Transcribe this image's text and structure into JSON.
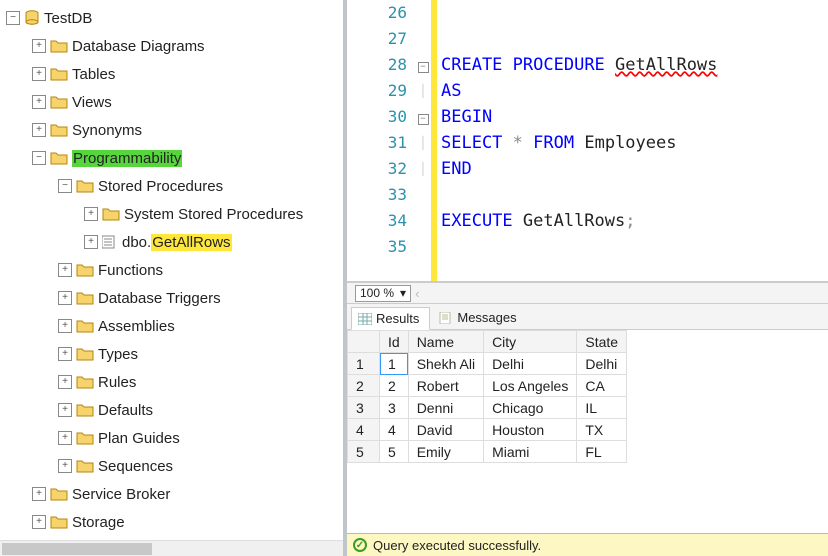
{
  "tree": {
    "root": "TestDB",
    "items": [
      {
        "label": "Database Diagrams",
        "indent": 1,
        "exp": "+",
        "icon": "folder"
      },
      {
        "label": "Tables",
        "indent": 1,
        "exp": "+",
        "icon": "folder"
      },
      {
        "label": "Views",
        "indent": 1,
        "exp": "+",
        "icon": "folder"
      },
      {
        "label": "Synonyms",
        "indent": 1,
        "exp": "+",
        "icon": "folder"
      },
      {
        "label": "Programmability",
        "indent": 1,
        "exp": "-",
        "icon": "folder",
        "hl": "green"
      },
      {
        "label": "Stored Procedures",
        "indent": 2,
        "exp": "-",
        "icon": "folder"
      },
      {
        "label": "System Stored Procedures",
        "indent": 3,
        "exp": "+",
        "icon": "folder"
      },
      {
        "label": "dbo.GetAllRows",
        "indent": 3,
        "exp": "+",
        "icon": "sp",
        "hl": "yellow",
        "hl_start": 4
      },
      {
        "label": "Functions",
        "indent": 2,
        "exp": "+",
        "icon": "folder"
      },
      {
        "label": "Database Triggers",
        "indent": 2,
        "exp": "+",
        "icon": "folder"
      },
      {
        "label": "Assemblies",
        "indent": 2,
        "exp": "+",
        "icon": "folder"
      },
      {
        "label": "Types",
        "indent": 2,
        "exp": "+",
        "icon": "folder"
      },
      {
        "label": "Rules",
        "indent": 2,
        "exp": "+",
        "icon": "folder"
      },
      {
        "label": "Defaults",
        "indent": 2,
        "exp": "+",
        "icon": "folder"
      },
      {
        "label": "Plan Guides",
        "indent": 2,
        "exp": "+",
        "icon": "folder"
      },
      {
        "label": "Sequences",
        "indent": 2,
        "exp": "+",
        "icon": "folder"
      },
      {
        "label": "Service Broker",
        "indent": 1,
        "exp": "+",
        "icon": "folder"
      },
      {
        "label": "Storage",
        "indent": 1,
        "exp": "+",
        "icon": "folder"
      }
    ]
  },
  "editor": {
    "line_start": 26,
    "lines": [
      {
        "n": 26,
        "fold": "",
        "html": ""
      },
      {
        "n": 27,
        "fold": "",
        "html": ""
      },
      {
        "n": 28,
        "fold": "-",
        "html": "<span class='kw'>CREATE</span> <span class='kw'>PROCEDURE</span> <span class='ident-wavy'>GetAllRows</span>"
      },
      {
        "n": 29,
        "fold": "|",
        "html": "<span class='kw'>AS</span>"
      },
      {
        "n": 30,
        "fold": "-",
        "html": "<span class='kw'>BEGIN</span>"
      },
      {
        "n": 31,
        "fold": "|",
        "html": "<span class='kw'>SELECT</span> <span class='op'>*</span> <span class='kw'>FROM</span> Employees"
      },
      {
        "n": 32,
        "fold": "|",
        "html": "<span class='kw'>END</span>"
      },
      {
        "n": 33,
        "fold": "",
        "html": ""
      },
      {
        "n": 34,
        "fold": "",
        "html": "<span class='kw'>EXECUTE</span> GetAllRows<span class='op'>;</span>"
      },
      {
        "n": 35,
        "fold": "",
        "html": ""
      }
    ]
  },
  "zoom": {
    "value": "100 %"
  },
  "tabs": {
    "results": "Results",
    "messages": "Messages"
  },
  "results": {
    "columns": [
      "",
      "Id",
      "Name",
      "City",
      "State"
    ],
    "rows": [
      [
        "1",
        "1",
        "Shekh Ali",
        "Delhi",
        "Delhi"
      ],
      [
        "2",
        "2",
        "Robert",
        "Los Angeles",
        "CA"
      ],
      [
        "3",
        "3",
        "Denni",
        "Chicago",
        "IL"
      ],
      [
        "4",
        "4",
        "David",
        "Houston",
        "TX"
      ],
      [
        "5",
        "5",
        "Emily",
        "Miami",
        "FL"
      ]
    ]
  },
  "status": {
    "text": "Query executed successfully."
  }
}
